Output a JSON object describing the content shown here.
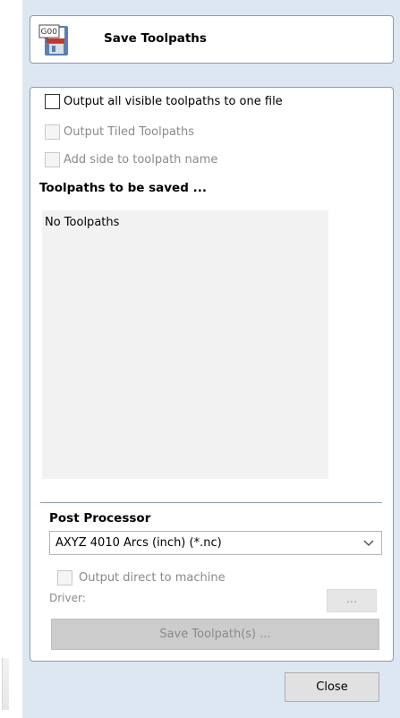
{
  "header": {
    "title": "Save Toolpaths",
    "icon": "save-toolpaths-floppy-icon",
    "icon_label": "G00"
  },
  "options": {
    "output_all_visible": {
      "label": "Output all visible toolpaths to one file",
      "checked": false,
      "enabled": true
    },
    "output_tiled": {
      "label": "Output Tiled Toolpaths",
      "checked": false,
      "enabled": false
    },
    "add_side": {
      "label": "Add side to toolpath name",
      "checked": false,
      "enabled": false
    }
  },
  "toolpaths_section": {
    "title": "Toolpaths to be saved ...",
    "empty_text": "No Toolpaths"
  },
  "post_processor": {
    "title": "Post Processor",
    "selected": "AXYZ 4010 Arcs (inch) (*.nc)",
    "output_direct": {
      "label": "Output direct to machine",
      "checked": false,
      "enabled": false
    },
    "driver_label": "Driver:",
    "browse_label": "...",
    "save_button": "Save Toolpath(s) ..."
  },
  "footer": {
    "close_button": "Close"
  },
  "colors": {
    "pane_bg": "#dde7f2",
    "border": "#8b9bb0",
    "disabled_text": "#8a8a8a"
  }
}
